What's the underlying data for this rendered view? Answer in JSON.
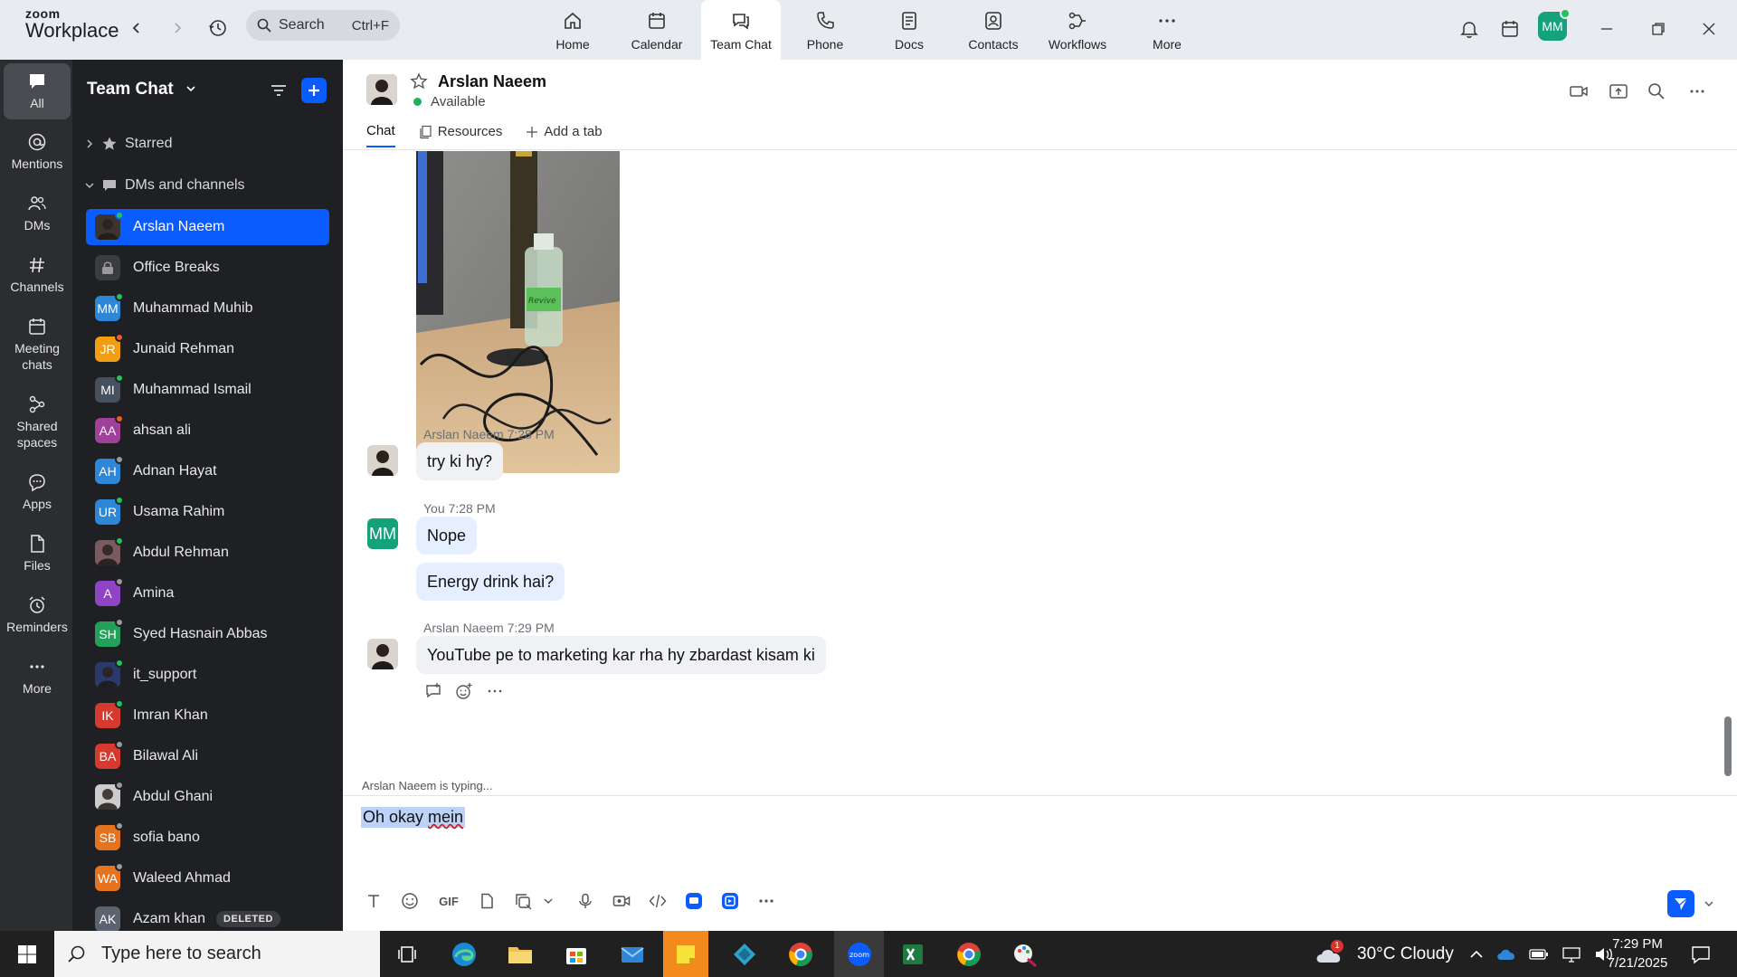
{
  "titlebar": {
    "logo_line1": "zoom",
    "logo_line2": "Workplace",
    "search_placeholder": "Search",
    "search_shortcut": "Ctrl+F",
    "tabs": [
      {
        "label": "Home",
        "icon": "home-icon"
      },
      {
        "label": "Calendar",
        "icon": "calendar-icon"
      },
      {
        "label": "Team Chat",
        "icon": "chat-icon"
      },
      {
        "label": "Phone",
        "icon": "phone-icon"
      },
      {
        "label": "Docs",
        "icon": "docs-icon"
      },
      {
        "label": "Contacts",
        "icon": "contacts-icon"
      },
      {
        "label": "Workflows",
        "icon": "workflows-icon"
      },
      {
        "label": "More",
        "icon": "more-icon"
      }
    ],
    "active_tab": "Team Chat",
    "avatar_initials": "MM"
  },
  "rail": {
    "items": [
      {
        "label": "All",
        "icon": "chat-bubble-icon"
      },
      {
        "label": "Mentions",
        "icon": "at-icon"
      },
      {
        "label": "DMs",
        "icon": "people-icon"
      },
      {
        "label": "Channels",
        "icon": "hash-icon"
      },
      {
        "label": "Meeting chats",
        "icon": "calendar-icon"
      },
      {
        "label": "Shared spaces",
        "icon": "shared-spaces-icon"
      },
      {
        "label": "Apps",
        "icon": "apps-icon"
      },
      {
        "label": "Files",
        "icon": "file-icon"
      },
      {
        "label": "Reminders",
        "icon": "alarm-icon"
      },
      {
        "label": "More",
        "icon": "ellipsis-icon"
      }
    ]
  },
  "sidebar": {
    "title": "Team Chat",
    "starred_label": "Starred",
    "dms_label": "DMs and channels",
    "deleted_label": "DELETED",
    "contacts": [
      {
        "name": "Arslan Naeem",
        "initials": "",
        "color": "#3b3530",
        "status": "#22c35a",
        "active": true,
        "photo": true
      },
      {
        "name": "Office Breaks",
        "initials": "",
        "color": "#3a3c42",
        "status": "",
        "lock": true
      },
      {
        "name": "Muhammad Muhib",
        "initials": "MM",
        "color": "#2e86d6",
        "status": "#22c35a"
      },
      {
        "name": "Junaid Rehman",
        "initials": "JR",
        "color": "#f29d12",
        "status": "#f05a28"
      },
      {
        "name": "Muhammad Ismail",
        "initials": "MI",
        "color": "#46505e",
        "status": "#22c35a"
      },
      {
        "name": "ahsan ali",
        "initials": "AA",
        "color": "#a0409a",
        "status": "#f05a28"
      },
      {
        "name": "Adnan Hayat",
        "initials": "AH",
        "color": "#2e86d6",
        "status": "#9a9a9a"
      },
      {
        "name": "Usama Rahim",
        "initials": "UR",
        "color": "#2e86d6",
        "status": "#22c35a"
      },
      {
        "name": "Abdul Rehman",
        "initials": "",
        "color": "#7a5a60",
        "status": "#22c35a",
        "photo": true
      },
      {
        "name": "Amina",
        "initials": "A",
        "color": "#8e44c4",
        "status": "#9a9a9a"
      },
      {
        "name": "Syed Hasnain Abbas",
        "initials": "SH",
        "color": "#23a15a",
        "status": "#9a9a9a"
      },
      {
        "name": "it_support",
        "initials": "",
        "color": "#2b3a6a",
        "status": "#22c35a",
        "photo": true
      },
      {
        "name": "Imran Khan",
        "initials": "IK",
        "color": "#d63a2e",
        "status": "#22c35a"
      },
      {
        "name": "Bilawal Ali",
        "initials": "BA",
        "color": "#d63a2e",
        "status": "#9a9a9a"
      },
      {
        "name": "Abdul Ghani",
        "initials": "",
        "color": "#cccccc",
        "status": "#9a9a9a",
        "photo": true
      },
      {
        "name": "sofia bano",
        "initials": "SB",
        "color": "#e6731e",
        "status": "#9a9a9a"
      },
      {
        "name": "Waleed Ahmad",
        "initials": "WA",
        "color": "#e6731e",
        "status": "#9a9a9a"
      },
      {
        "name": "Azam khan",
        "initials": "AK",
        "color": "#5b6270",
        "status": "",
        "deleted": true
      }
    ]
  },
  "channel": {
    "name": "Arslan Naeem",
    "status": "Available",
    "tabs": [
      "Chat",
      "Resources",
      "Add a tab"
    ]
  },
  "messages": {
    "m1": {
      "sender": "Arslan Naeem",
      "time": "7:28 PM",
      "text": "try ki hy?"
    },
    "m2": {
      "sender": "You",
      "time": "7:28 PM",
      "text": "Nope",
      "avatar": "MM"
    },
    "m3": {
      "text": "Energy drink hai?"
    },
    "m4": {
      "sender": "Arslan Naeem",
      "time": "7:29 PM",
      "text": "YouTube pe to marketing kar rha hy zbardast kisam ki"
    },
    "photo_label": "Revive",
    "typing": "Arslan Naeem  is typing..."
  },
  "composer": {
    "draft_start": "Oh okay ",
    "draft_underlined": "mein",
    "gif_label": "GIF"
  },
  "taskbar": {
    "search_placeholder": "Type here to search",
    "weather": "30°C  Cloudy",
    "weather_badge": "1",
    "time": "7:29 PM",
    "date": "7/21/2025"
  },
  "colors": {
    "accent": "#0b5cff",
    "online": "#22c35a",
    "brand_green": "#15a27a"
  }
}
